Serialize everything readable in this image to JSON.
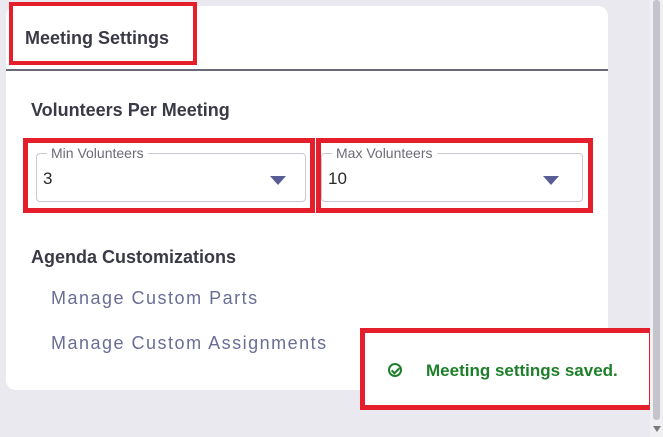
{
  "card": {
    "title": "Meeting Settings",
    "volunteers_section": "Volunteers Per Meeting",
    "min_volunteers": {
      "label": "Min Volunteers",
      "value": "3"
    },
    "max_volunteers": {
      "label": "Max Volunteers",
      "value": "10"
    },
    "agenda_section": "Agenda Customizations",
    "links": {
      "custom_parts": "Manage Custom Parts",
      "custom_assignments": "Manage Custom Assignments"
    }
  },
  "toast": {
    "message": "Meeting settings saved.",
    "icon": "check-circle-icon"
  },
  "colors": {
    "accent": "#5a5c96",
    "success": "#1d7f2a",
    "highlight": "#e41e2b"
  }
}
